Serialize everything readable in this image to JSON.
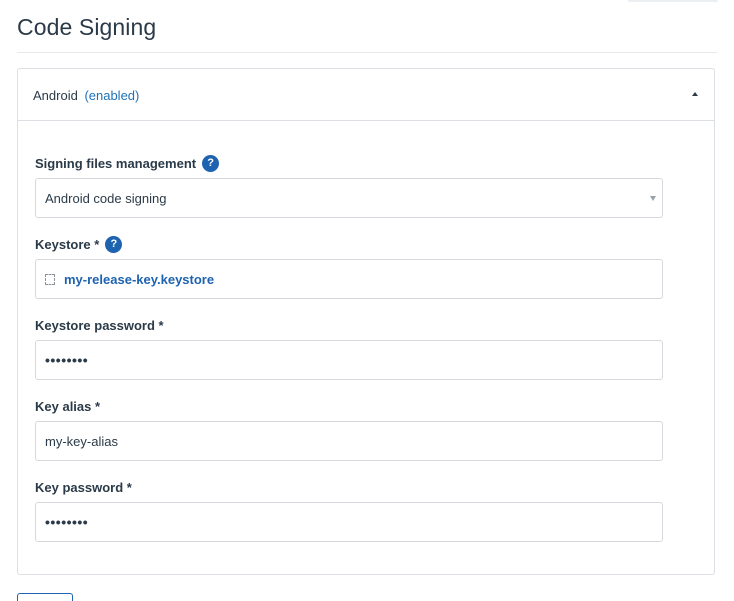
{
  "page": {
    "title": "Code Signing"
  },
  "panel": {
    "title": "Android",
    "status": "(enabled)"
  },
  "fields": {
    "signing_files": {
      "label": "Signing files management",
      "value": "Android code signing",
      "help": "?"
    },
    "keystore": {
      "label": "Keystore *",
      "file": "my-release-key.keystore",
      "help": "?"
    },
    "keystore_password": {
      "label": "Keystore password *",
      "value": "••••••••"
    },
    "key_alias": {
      "label": "Key alias *",
      "value": "my-key-alias"
    },
    "key_password": {
      "label": "Key password *",
      "value": "••••••••"
    }
  },
  "colors": {
    "accent": "#1e63b0",
    "border": "#d5d9dd",
    "text": "#2b3a48"
  }
}
